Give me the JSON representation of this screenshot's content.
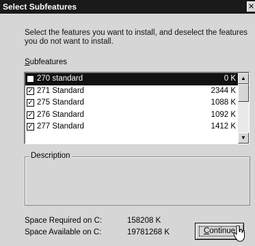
{
  "window": {
    "title": "Select Subfeatures",
    "close_glyph": "✕"
  },
  "instructions": "Select the features you want to install, and deselect the features you do not want to install.",
  "subfeatures": {
    "label_first": "S",
    "label_rest": "ubfeatures",
    "items": [
      {
        "name": "270 standard",
        "size": "0 K",
        "checked": false,
        "selected": true
      },
      {
        "name": "271 Standard",
        "size": "2344 K",
        "checked": true,
        "selected": false
      },
      {
        "name": "275 Standard",
        "size": "1088 K",
        "checked": true,
        "selected": false
      },
      {
        "name": "276 Standard",
        "size": "1092 K",
        "checked": true,
        "selected": false
      },
      {
        "name": "277 Standard",
        "size": "1412 K",
        "checked": true,
        "selected": false
      }
    ],
    "scroll_up_glyph": "▲",
    "scroll_down_glyph": "▼"
  },
  "description": {
    "label": "Description"
  },
  "space": {
    "required_label": "Space Required on C:",
    "required_value": "158208 K",
    "available_label": "Space Available on C:",
    "available_value": "19781268 K"
  },
  "buttons": {
    "continue_first": "C",
    "continue_rest": "ontinue"
  },
  "icons": {
    "checkmark": "check-icon",
    "cursor": "mouse-pointer-icon"
  }
}
